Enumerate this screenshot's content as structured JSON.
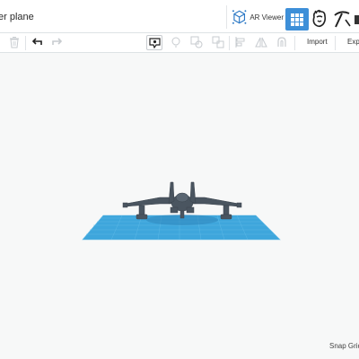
{
  "header": {
    "document_title": "er plane",
    "ar_viewer_label": "AR Viewer"
  },
  "toolbar": {
    "import_label": "Import",
    "export_label": "Expo"
  },
  "viewport": {
    "snap_grid_label": "Snap Grid"
  },
  "colors": {
    "accent": "#3d8fd8",
    "workplane": "#3ea6dc",
    "model": "#4a5560"
  }
}
